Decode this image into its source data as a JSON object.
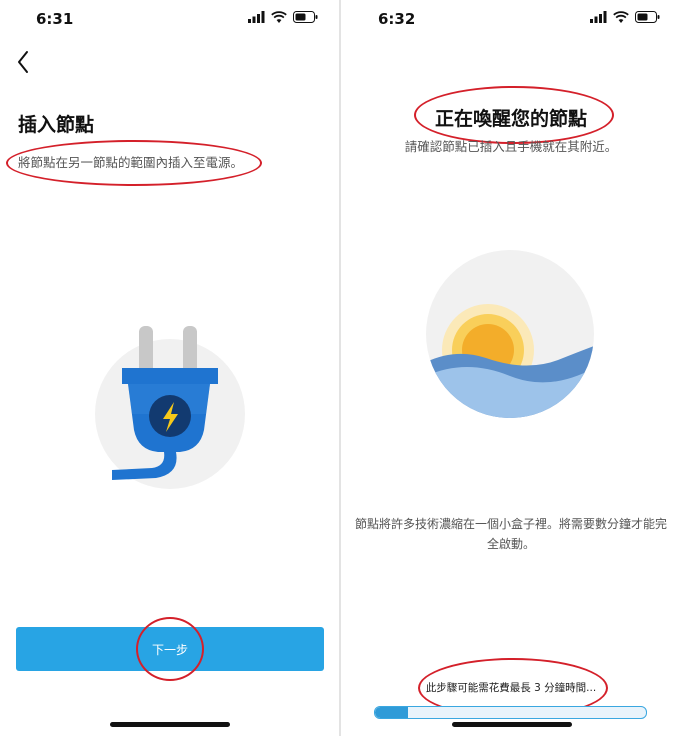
{
  "left_screen": {
    "status_time": "6:31",
    "title": "插入節點",
    "subtitle": "將節點在另一節點的範圍內插入至電源。",
    "next_label": "下一步",
    "illustration_icon": "power-plug-icon"
  },
  "right_screen": {
    "status_time": "6:32",
    "title": "正在喚醒您的節點",
    "subtitle": "請確認節點已插入且手機就在其附近。",
    "description_line1": "節點將許多技術濃縮在一個小盒子裡。將需要數分鐘才能完",
    "description_line2": "全啟動。",
    "progress_text": "此步驟可能需花費最長 3 分鐘時間...",
    "progress": 0.12,
    "illustration_icon": "sunrise-icon"
  },
  "colors": {
    "accent": "#28a4e4",
    "annotation": "#d4202a",
    "plug_blue": "#1f74d0",
    "bolt_yellow": "#f7c91a"
  }
}
